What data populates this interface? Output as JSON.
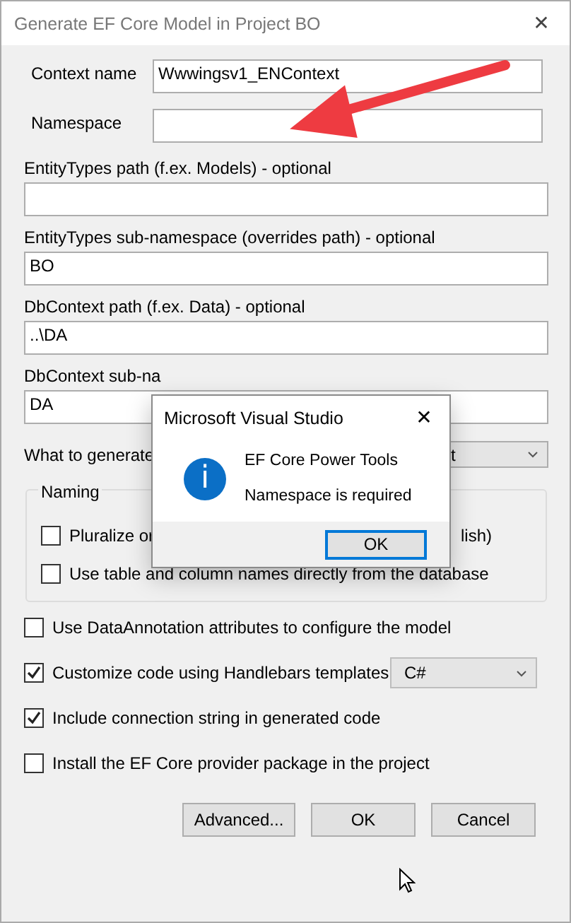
{
  "window": {
    "title": "Generate EF Core Model in Project BO",
    "close": "✕"
  },
  "inline_fields": [
    {
      "label": "Context name",
      "value": "Wwwingsv1_ENContext"
    },
    {
      "label": "Namespace"
    }
  ],
  "fields": [
    {
      "label": "EntityTypes path (f.ex. Models) - optional"
    },
    {
      "label": "EntityTypes sub-namespace (overrides path) - optional",
      "value": "BO"
    },
    {
      "label": "DbContext path (f.ex. Data) - optional",
      "value": "..\\DA"
    },
    {
      "label": "DbContext sub-na",
      "value": "DA"
    }
  ],
  "generate": {
    "label": "What to generate",
    "value": "t"
  },
  "naming": {
    "title": "Naming",
    "options": [
      {
        "label": "Pluralize or",
        "tail": "lish)",
        "checked": false
      },
      {
        "label": "Use table and column names directly from the database",
        "checked": false
      }
    ]
  },
  "options": [
    {
      "label": "Use DataAnnotation attributes to configure the model",
      "checked": false
    },
    {
      "label": "Customize code using Handlebars templates",
      "checked": true,
      "select": "C#"
    },
    {
      "label": "Include connection string in generated code",
      "checked": true
    },
    {
      "label": "Install the EF Core provider package in the project",
      "checked": false
    }
  ],
  "buttons": [
    {
      "label": "Advanced...",
      "kind": "advanced"
    },
    {
      "label": "OK",
      "kind": "ok"
    },
    {
      "label": "Cancel",
      "kind": "cancel"
    }
  ],
  "message_box": {
    "title": "Microsoft Visual Studio",
    "close": "✕",
    "icon_letter": "i",
    "heading": "EF Core Power Tools",
    "message": "Namespace is required",
    "button": "OK"
  }
}
